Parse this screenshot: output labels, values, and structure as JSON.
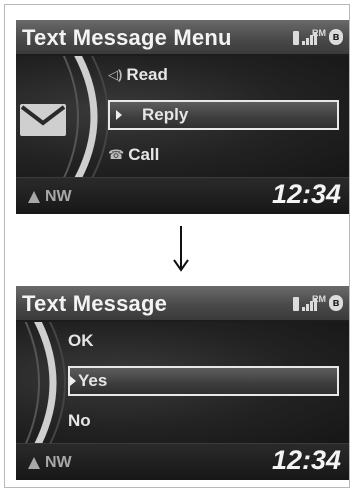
{
  "screens": [
    {
      "title": "Text Message Menu",
      "status": {
        "roaming": "RM",
        "bluetooth": "ʙ"
      },
      "menu": [
        {
          "label": "Read",
          "icon": "speaker-icon",
          "glyph": "◁)"
        },
        {
          "label": "Reply",
          "icon": "",
          "glyph": ""
        },
        {
          "label": "Call",
          "icon": "phone-handset-icon",
          "glyph": "☎"
        }
      ],
      "selected_index": 1,
      "compass": "NW",
      "clock": "12:34"
    },
    {
      "title": "Text Message",
      "status": {
        "roaming": "RM",
        "bluetooth": "ʙ"
      },
      "menu": [
        {
          "label": "OK"
        },
        {
          "label": "Yes"
        },
        {
          "label": "No"
        }
      ],
      "selected_index": 1,
      "compass": "NW",
      "clock": "12:34"
    }
  ],
  "colors": {
    "selection_border": "#e8e8e8",
    "screen_background": "#141414"
  }
}
